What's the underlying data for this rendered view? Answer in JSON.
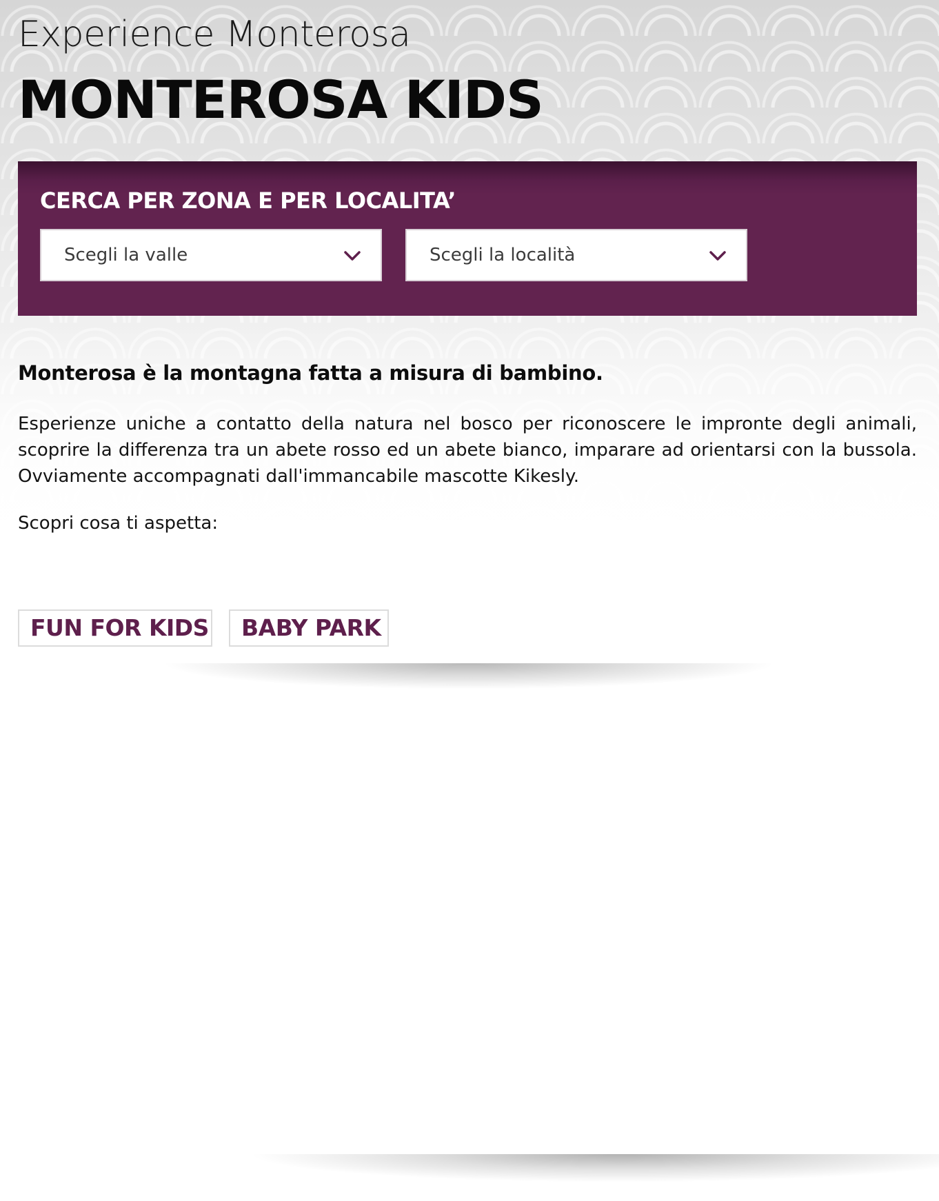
{
  "header": {
    "kicker": "Experience Monterosa",
    "title": "MONTEROSA KIDS"
  },
  "search": {
    "title": "CERCA PER ZONA E PER LOCALITA’",
    "valle_select": {
      "value": "Scegli la valle",
      "icon": "chevron-down-icon"
    },
    "localita_select": {
      "value": "Scegli la località",
      "icon": "chevron-down-icon"
    }
  },
  "intro": {
    "lead": "Monterosa è la montagna fatta a misura di bambino.",
    "body": "Esperienze uniche a contatto della natura nel bosco per riconoscere le impronte degli animali, scoprire la differenza tra un abete rosso ed un abete bianco, imparare ad orientarsi con la bussola. Ovviamente accompagnati dall'immancabile mascotte Kikesly.",
    "cta": "Scopri cosa ti aspetta:"
  },
  "tags": [
    {
      "label": "FUN FOR KIDS"
    },
    {
      "label": "BABY PARK"
    }
  ],
  "colors": {
    "brand_purple": "#62234f",
    "tag_text": "#5e1f4c",
    "panel_dark": "#3b1230"
  }
}
